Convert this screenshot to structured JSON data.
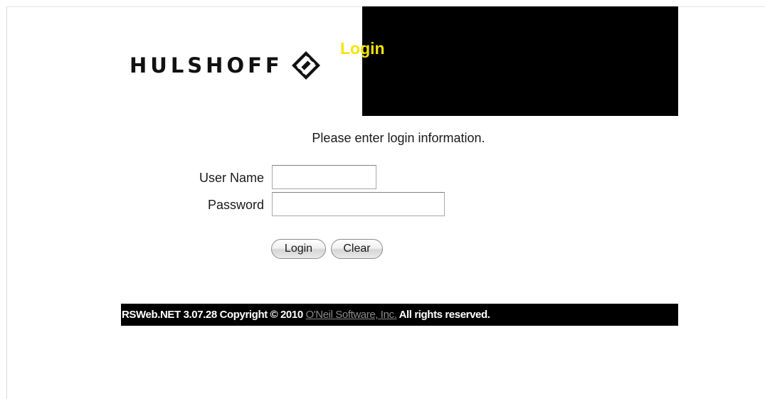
{
  "header": {
    "logo_text": "HULSHOFF",
    "title": "Login"
  },
  "login_form": {
    "instructions": "Please enter login information.",
    "username_label": "User Name",
    "username_value": "",
    "password_label": "Password",
    "password_value": "",
    "login_button": "Login",
    "clear_button": "Clear"
  },
  "footer": {
    "text_before": "RSWeb.NET 3.07.28 Copyright © 2010 ",
    "link_text": "O'Neil Software, Inc.",
    "text_after": " All rights reserved."
  },
  "colors": {
    "title": "#f6e400",
    "header_box": "#000000",
    "footer_bar": "#000000",
    "footer_link": "#8a8a8a"
  },
  "icons": {
    "logo_emblem": "hulshoff-diamond-logo-icon"
  }
}
